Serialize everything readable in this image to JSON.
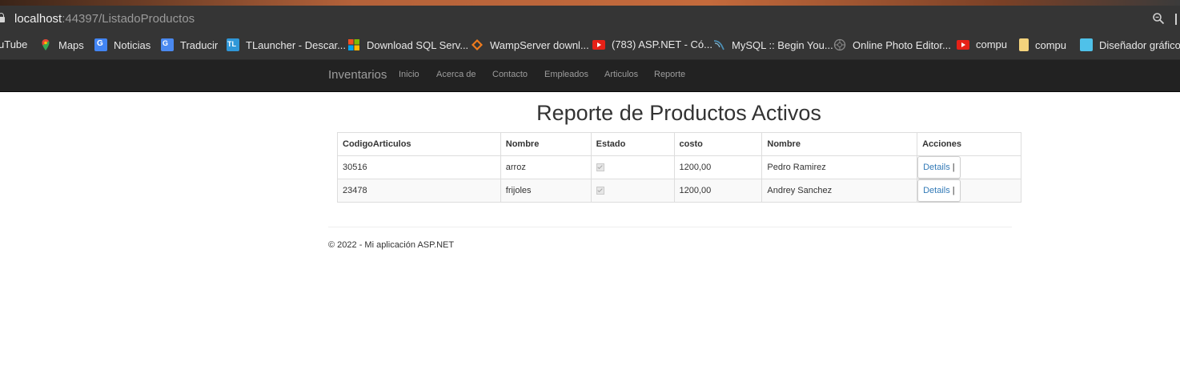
{
  "browser": {
    "url_host": "localhost",
    "url_rest": ":44397/ListadoProductos"
  },
  "bookmarks": [
    {
      "label": "uTube",
      "icon": "youtube-icon"
    },
    {
      "label": "Maps",
      "icon": "maps-pin-icon"
    },
    {
      "label": "Noticias",
      "icon": "google-news-icon"
    },
    {
      "label": "Traducir",
      "icon": "google-translate-icon"
    },
    {
      "label": "TLauncher - Descar...",
      "icon": "tlauncher-icon"
    },
    {
      "label": "Download SQL Serv...",
      "icon": "microsoft-logo-icon"
    },
    {
      "label": "WampServer downl...",
      "icon": "wampserver-icon"
    },
    {
      "label": "(783) ASP.NET - Có...",
      "icon": "youtube-icon"
    },
    {
      "label": "MySQL :: Begin You...",
      "icon": "mysql-icon"
    },
    {
      "label": "Online Photo Editor...",
      "icon": "photo-editor-icon"
    },
    {
      "label": "compu",
      "icon": "youtube-icon"
    },
    {
      "label": "compu",
      "icon": "folder-icon"
    },
    {
      "label": "Diseñador gráfico c",
      "icon": "designer-icon"
    }
  ],
  "navbar": {
    "brand": "Inventarios",
    "links": [
      "Inicio",
      "Acerca de",
      "Contacto",
      "Empleados",
      "Articulos",
      "Reporte"
    ]
  },
  "page": {
    "title": "Reporte de Productos Activos"
  },
  "table": {
    "headers": [
      "CodigoArticulos",
      "Nombre",
      "Estado",
      "costo",
      "Nombre",
      "Acciones"
    ],
    "rows": [
      {
        "codigo": "30516",
        "nombre": "arroz",
        "estado_checked": true,
        "costo": "1200,00",
        "empleado": "Pedro Ramirez",
        "accion": "Details",
        "separator": "|"
      },
      {
        "codigo": "23478",
        "nombre": "frijoles",
        "estado_checked": true,
        "costo": "1200,00",
        "empleado": "Andrey Sanchez",
        "accion": "Details",
        "separator": "|"
      }
    ]
  },
  "footer": {
    "text": "© 2022 - Mi aplicación ASP.NET"
  },
  "colors": {
    "navbar_bg": "#222222",
    "chrome_bg": "#353535",
    "link": "#337ab7"
  }
}
